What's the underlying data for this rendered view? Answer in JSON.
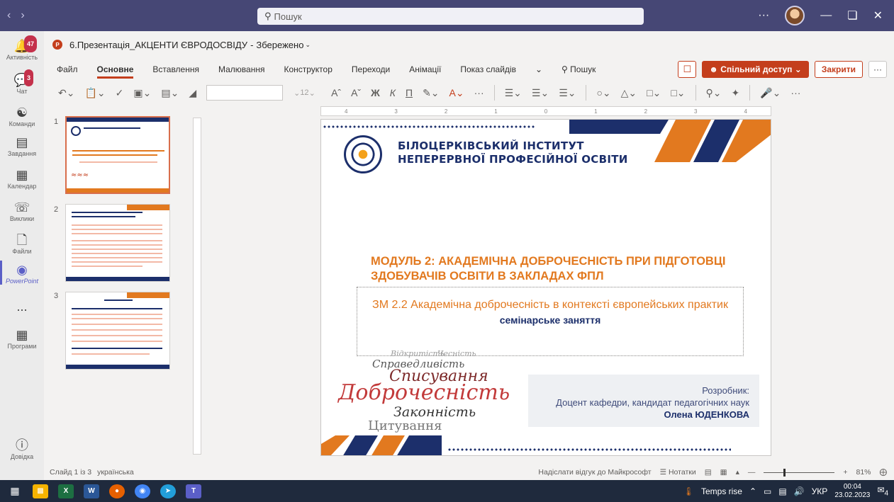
{
  "teams": {
    "search_placeholder": "Пошук",
    "rail": [
      {
        "label": "Активність",
        "badge": "47"
      },
      {
        "label": "Чат",
        "badge": "3"
      },
      {
        "label": "Команди"
      },
      {
        "label": "Завдання"
      },
      {
        "label": "Календар"
      },
      {
        "label": "Виклики"
      },
      {
        "label": "Файли"
      },
      {
        "label": "PowerPoint"
      },
      {
        "label": "..."
      },
      {
        "label": "Програми"
      },
      {
        "label": "Довідка"
      }
    ]
  },
  "document": {
    "title": "6.Презентація_АКЦЕНТИ ЄВРОДОСВІДУ",
    "save_status": "Збережено"
  },
  "ribbon": {
    "tabs": [
      "Файл",
      "Основне",
      "Вставлення",
      "Малювання",
      "Конструктор",
      "Переходи",
      "Анімації",
      "Показ слайдів"
    ],
    "search_label": "Пошук",
    "share_label": "Спільний доступ",
    "close_label": "Закрити",
    "font_size": "12"
  },
  "thumbnails": [
    {
      "number": "1",
      "selected": true
    },
    {
      "number": "2",
      "selected": false
    },
    {
      "number": "3",
      "selected": false
    }
  ],
  "slide": {
    "institute_line1": "БІЛОЦЕРКІВСЬКИЙ ІНСТИТУТ",
    "institute_line2": "НЕПЕРЕРВНОЇ ПРОФЕСІЙНОЇ ОСВІТИ",
    "module_title": "МОДУЛЬ 2: АКАДЕМІЧНА ДОБРОЧЕСНІСТЬ ПРИ ПІДГОТОВЦІ ЗДОБУВАЧІВ ОСВІТИ В ЗАКЛАДАХ ФПЛ",
    "submodule": "ЗМ 2.2 Академічна доброчесність в контексті європейських практик",
    "lesson_type": "семінарське заняття",
    "author_label": "Розробник:",
    "author_position": "Доцент кафедри, кандидат педагогічних наук",
    "author_name": "Олена ЮДЕНКОВА",
    "wordcloud": {
      "w1": "Доброчесність",
      "w2": "Списування",
      "w3": "Законність",
      "w4": "Цитування",
      "w5": "Справедливість",
      "w6": "Відкритість",
      "w7": "Чесність"
    }
  },
  "statusbar": {
    "slide_info": "Слайд 1 із 3",
    "language": "українська",
    "feedback": "Надіслати відгук до Майкрософт",
    "notes": "Нотатки",
    "zoom": "81%"
  },
  "taskbar": {
    "weather": "Temps rise",
    "lang": "УКР",
    "time": "00:04",
    "date": "23.02.2023",
    "notifications": "4"
  },
  "colors": {
    "accent": "#c43e1c",
    "teams_bar": "#464775",
    "navy": "#1c2f6b",
    "orange": "#e2791f"
  }
}
